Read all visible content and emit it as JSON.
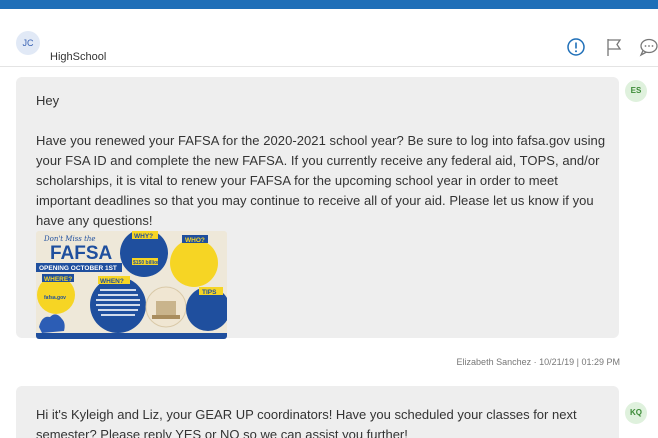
{
  "header": {
    "avatar_initials": "JC",
    "name": "HighSchool",
    "icons": [
      "info-alert-icon",
      "flag-icon",
      "comment-icon"
    ],
    "accent_color": "#1f6fb8"
  },
  "messages": [
    {
      "avatar_initials": "ES",
      "greeting": "Hey",
      "body": "Have you renewed your FAFSA for the 2020-2021 school year? Be sure to log into fafsa.gov using your FSA ID and complete the new FAFSA. If you currently receive any federal aid, TOPS, and/or scholarships, it is vital to renew your FAFSA for the upcoming school year in order to meet important deadlines so that you may continue to receive all of your aid. Please let us know if you have any questions!",
      "attachment": {
        "title_top": "Don't Miss the",
        "title_main": "FAFSA",
        "opening_banner": "OPENING OCTOBER 1ST",
        "why_label": "WHY?",
        "who_label": "WHO?",
        "where_label": "WHERE?",
        "when_label": "WHEN?",
        "tips_label": "TIPS",
        "amount": "$150 billion",
        "site": "fafsa.gov"
      },
      "meta": "Elizabeth Sanchez · 10/21/19 | 01:29 PM"
    },
    {
      "avatar_initials": "KQ",
      "body": "Hi          it's Kyleigh and Liz, your GEAR UP coordinators! Have you scheduled your classes for next semester? Please reply YES or NO so we can assist you further!"
    }
  ]
}
